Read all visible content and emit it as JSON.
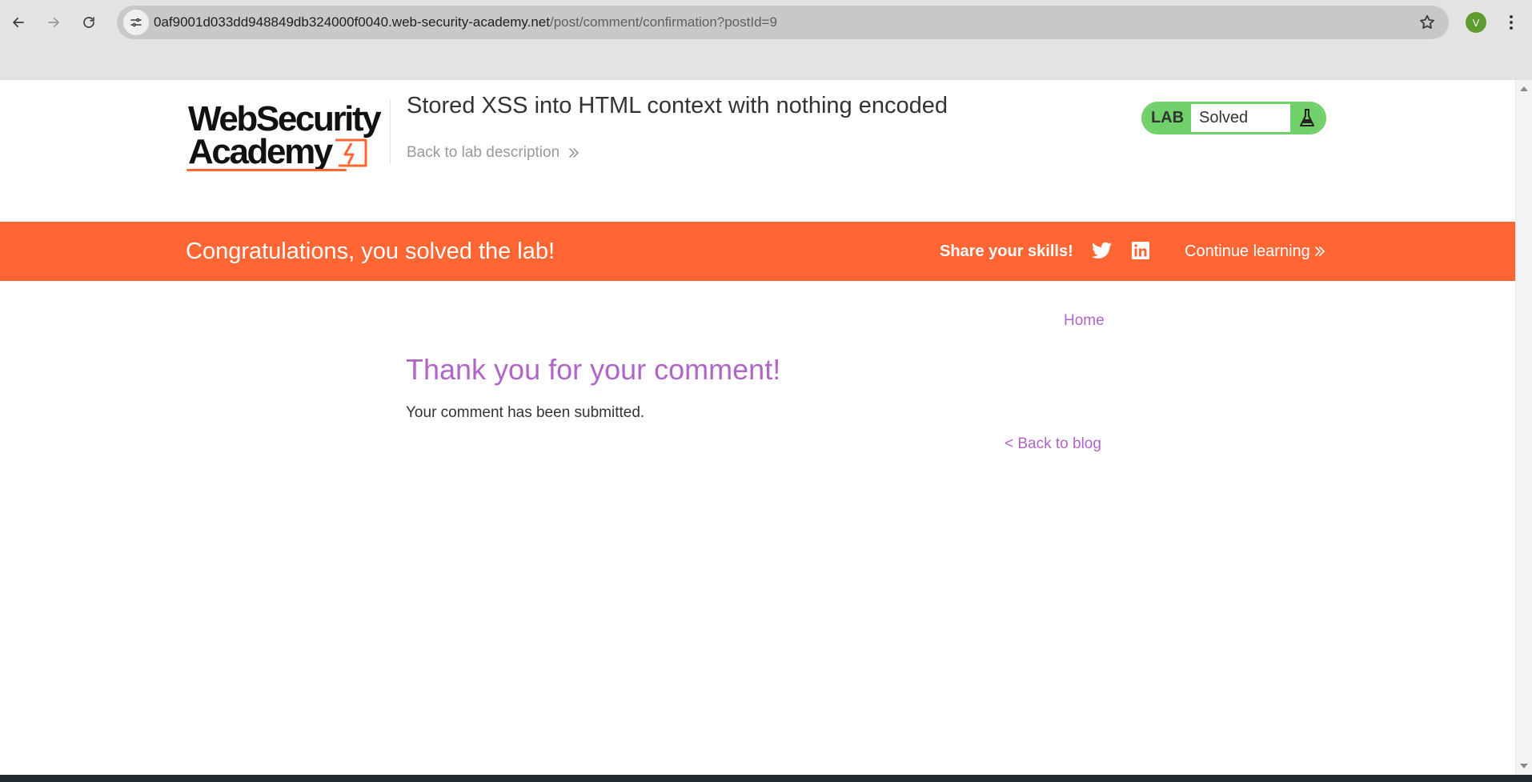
{
  "browser": {
    "url_host": "0af9001d033dd948849db324000f0040.web-security-academy.net",
    "url_path": "/post/comment/confirmation?postId=9",
    "profile_initial": "V"
  },
  "header": {
    "logo_line1": "WebSecurity",
    "logo_line2": "Academy",
    "lab_title": "Stored XSS into HTML context with nothing encoded",
    "back_to_description": "Back to lab description"
  },
  "lab_status": {
    "label": "LAB",
    "status": "Solved"
  },
  "banner": {
    "message": "Congratulations, you solved the lab!",
    "share": "Share your skills!",
    "continue": "Continue learning"
  },
  "content": {
    "home": "Home",
    "heading": "Thank you for your comment!",
    "body": "Your comment has been submitted.",
    "back_to_blog": "< Back to blog"
  },
  "colors": {
    "brand_orange": "#ff6633",
    "solved_green": "#70d16a",
    "link_purple": "#b066c6"
  }
}
